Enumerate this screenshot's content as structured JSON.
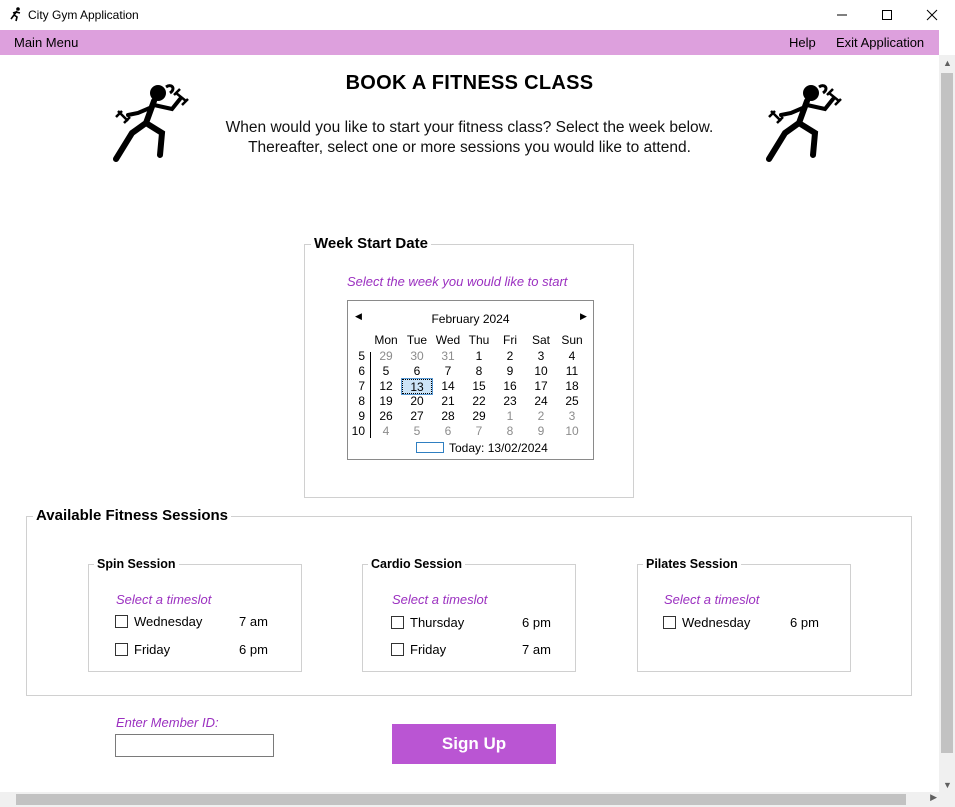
{
  "window": {
    "title": "City Gym Application"
  },
  "menu": {
    "main": "Main Menu",
    "help": "Help",
    "exit": "Exit Application"
  },
  "header": {
    "title": "BOOK A FITNESS CLASS",
    "line1": "When would you like to start your fitness class? Select the week below.",
    "line2": "Thereafter, select one or more sessions you would like to attend."
  },
  "week": {
    "group_label": "Week Start Date",
    "hint": "Select the week you would like to start",
    "calendar": {
      "month": "February 2024",
      "days": [
        "Mon",
        "Tue",
        "Wed",
        "Thu",
        "Fri",
        "Sat",
        "Sun"
      ],
      "rows": [
        {
          "week": "5",
          "dates": [
            "29",
            "30",
            "31",
            "1",
            "2",
            "3",
            "4"
          ],
          "dim": [
            true,
            true,
            true,
            false,
            false,
            false,
            false
          ]
        },
        {
          "week": "6",
          "dates": [
            "5",
            "6",
            "7",
            "8",
            "9",
            "10",
            "11"
          ],
          "dim": [
            false,
            false,
            false,
            false,
            false,
            false,
            false
          ]
        },
        {
          "week": "7",
          "dates": [
            "12",
            "13",
            "14",
            "15",
            "16",
            "17",
            "18"
          ],
          "dim": [
            false,
            false,
            false,
            false,
            false,
            false,
            false
          ]
        },
        {
          "week": "8",
          "dates": [
            "19",
            "20",
            "21",
            "22",
            "23",
            "24",
            "25"
          ],
          "dim": [
            false,
            false,
            false,
            false,
            false,
            false,
            false
          ]
        },
        {
          "week": "9",
          "dates": [
            "26",
            "27",
            "28",
            "29",
            "1",
            "2",
            "3"
          ],
          "dim": [
            false,
            false,
            false,
            false,
            true,
            true,
            true
          ]
        },
        {
          "week": "10",
          "dates": [
            "4",
            "5",
            "6",
            "7",
            "8",
            "9",
            "10"
          ],
          "dim": [
            true,
            true,
            true,
            true,
            true,
            true,
            true
          ]
        }
      ],
      "selected": "13",
      "today": "Today: 13/02/2024"
    }
  },
  "sessions": {
    "group_label": "Available Fitness Sessions",
    "spin": {
      "label": "Spin Session",
      "hint": "Select a timeslot",
      "slots": [
        {
          "day": "Wednesday",
          "time": "7 am"
        },
        {
          "day": "Friday",
          "time": "6 pm"
        }
      ]
    },
    "cardio": {
      "label": "Cardio Session",
      "hint": "Select a timeslot",
      "slots": [
        {
          "day": "Thursday",
          "time": "6 pm"
        },
        {
          "day": "Friday",
          "time": "7 am"
        }
      ]
    },
    "pilates": {
      "label": "Pilates Session",
      "hint": "Select a timeslot",
      "slots": [
        {
          "day": "Wednesday",
          "time": "6 pm"
        }
      ]
    }
  },
  "member": {
    "label": "Enter Member ID:",
    "value": ""
  },
  "signup": {
    "label": "Sign Up"
  },
  "colors": {
    "menubar": "#dda0dd",
    "accent": "#ba55d3",
    "hint": "#9b30c0"
  },
  "icons": {
    "app": "runner-icon",
    "decor": "runner-dumbbell-icon"
  }
}
